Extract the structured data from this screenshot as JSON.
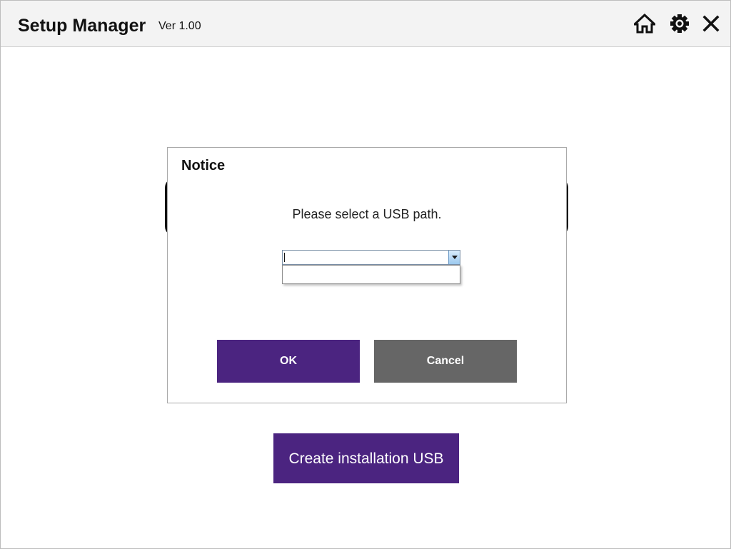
{
  "app": {
    "title": "Setup Manager",
    "version": "Ver 1.00"
  },
  "titlebar_icons": [
    "home-icon",
    "gear-icon",
    "close-icon"
  ],
  "main": {
    "create_usb_label": "Create installation USB"
  },
  "dialog": {
    "title": "Notice",
    "message": "Please select a USB path.",
    "usb_select": {
      "value": "",
      "options": []
    },
    "ok_label": "OK",
    "cancel_label": "Cancel"
  },
  "colors": {
    "accent": "#4b2480",
    "cancel": "#666666",
    "titlebar_bg": "#f3f3f3"
  }
}
